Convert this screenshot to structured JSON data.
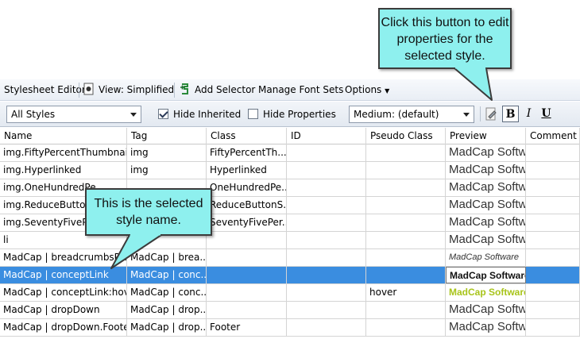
{
  "toolbar": {
    "title": "Stylesheet Editor",
    "view_label": "View: Simplified",
    "add_selector_label": "Add Selector",
    "manage_fonts_label": "Manage Font Sets",
    "options_label": "Options"
  },
  "filter_bar": {
    "styles_combo": "All Styles",
    "hide_inherited_label": "Hide Inherited",
    "hide_inherited_checked": true,
    "hide_properties_label": "Hide Properties",
    "hide_properties_checked": false,
    "medium_combo": "Medium: (default)",
    "bold_label": "B",
    "italic_label": "I",
    "underline_label": "U"
  },
  "columns": [
    "Name",
    "Tag",
    "Class",
    "ID",
    "Pseudo Class",
    "Preview",
    "Comment"
  ],
  "rows": [
    {
      "name": "img.FiftyPercentThumbnail",
      "tag": "img",
      "class": "FiftyPercentTh...",
      "id": "",
      "pseudo": "",
      "preview": "MadCap Softwa"
    },
    {
      "name": "img.Hyperlinked",
      "tag": "img",
      "class": "Hyperlinked",
      "id": "",
      "pseudo": "",
      "preview": "MadCap Softwa"
    },
    {
      "name": "img.OneHundredPe",
      "tag": "",
      "class": "OneHundredPe...",
      "id": "",
      "pseudo": "",
      "preview": "MadCap Softwa"
    },
    {
      "name": "img.ReduceButtonS",
      "tag": "",
      "class": "ReduceButtonS...",
      "id": "",
      "pseudo": "",
      "preview": "MadCap Softwa"
    },
    {
      "name": "img.SeventyFivePer",
      "tag": "",
      "class": "SeventyFivePer...",
      "id": "",
      "pseudo": "",
      "preview": "MadCap Softwa"
    },
    {
      "name": "li",
      "tag": "",
      "class": "",
      "id": "",
      "pseudo": "",
      "preview": "MadCap Softwa"
    },
    {
      "name": "MadCap | breadcrumbsPro",
      "tag": "MadCap | brea...",
      "class": "",
      "id": "",
      "pseudo": "",
      "preview": "MadCap Software"
    },
    {
      "name": "MadCap | conceptLink",
      "tag": "MadCap | conc...",
      "class": "",
      "id": "",
      "pseudo": "",
      "preview": "MadCap Software"
    },
    {
      "name": "MadCap | conceptLink:hover",
      "tag": "MadCap | conc...",
      "class": "",
      "id": "",
      "pseudo": "hover",
      "preview": "MadCap Software"
    },
    {
      "name": "MadCap | dropDown",
      "tag": "MadCap | drop...",
      "class": "",
      "id": "",
      "pseudo": "",
      "preview": "MadCap Softwa"
    },
    {
      "name": "MadCap | dropDown.Footer",
      "tag": "MadCap | drop...",
      "class": "Footer",
      "id": "",
      "pseudo": "",
      "preview": "MadCap Softwa"
    }
  ],
  "selected_row_color": "#3a8de0",
  "callouts": {
    "top": "Click this button to edit properties for the selected style.",
    "left": "This is the selected style name."
  }
}
